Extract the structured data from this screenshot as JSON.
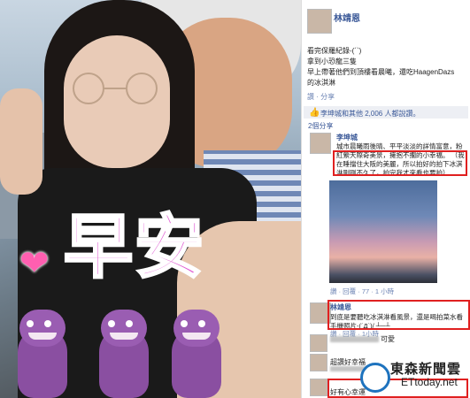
{
  "photo": {
    "overlay_text": "早安",
    "heart_icon": "heart-icon"
  },
  "post": {
    "poster_name": "林靖恩",
    "lines": [
      "看完保羅紀錄-(´`)",
      "拿到小恐龍三隻",
      "早上帶著他們到頂樓看晨曦，還吃HaagenDazs",
      "的冰淇淋"
    ],
    "share_label": "讚 · 分享",
    "likes_text": "李坤城和其他 2,006 人都說讚。",
    "shares_text": "2個分享"
  },
  "comment1": {
    "name": "李坤城",
    "text": "城市晨曦雨後晴、平平淡淡的詳情富意，粉紅縈天際奇美景，擁抱不擱的小幸福。",
    "highlight": "（我在睡擋住大阪的美麗，所以拍好的拍下冰淇淋剛剛不久了，拍完我才來看也要拍）",
    "meta": "讚 · 回覆 · 77 · 1 小時"
  },
  "comment2": {
    "name": "林靖恩",
    "text": "到底是要聽吃冰淇淋看風景，還是喝拍菜水看手機照片-(´Д`)/ ┴─┴",
    "meta": "讚 · 回覆 · 1小時"
  },
  "comment3": {
    "text": "可愛"
  },
  "comment4": {
    "text": "超讚好幸福"
  },
  "comment5": {
    "text": "好有心幸運"
  },
  "watermark": {
    "brand": "東森新聞雲",
    "url": "ETtoday.net"
  }
}
